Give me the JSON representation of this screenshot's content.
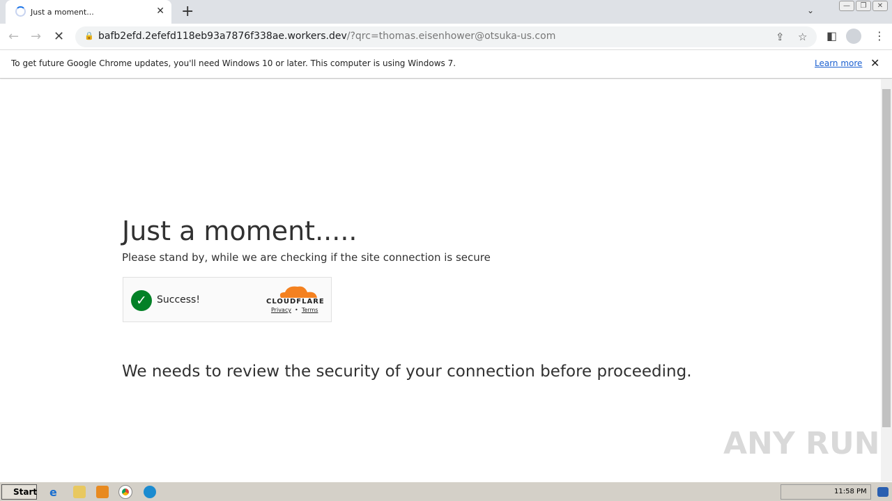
{
  "browser": {
    "tab_title": "Just a moment...",
    "url_host": "bafb2efd.2efefd118eb93a7876f338ae.workers.dev",
    "url_query": "/?qrc=thomas.eisenhower@otsuka-us.com"
  },
  "infobar": {
    "message": "To get future Google Chrome updates, you'll need Windows 10 or later. This computer is using Windows 7.",
    "link": "Learn more"
  },
  "page": {
    "title": "Just a moment.....",
    "subtitle": "Please stand by, while we are checking if the site connection is secure",
    "widget": {
      "status": "Success!",
      "brand": "CLOUDFLARE",
      "privacy": "Privacy",
      "terms": "Terms"
    },
    "message": "We needs to review the security of your connection before proceeding."
  },
  "watermark": "ANY RUN",
  "taskbar": {
    "start": "Start",
    "clock": "11:58 PM"
  },
  "colors": {
    "success": "#038127",
    "cloudflare": "#f48120"
  }
}
